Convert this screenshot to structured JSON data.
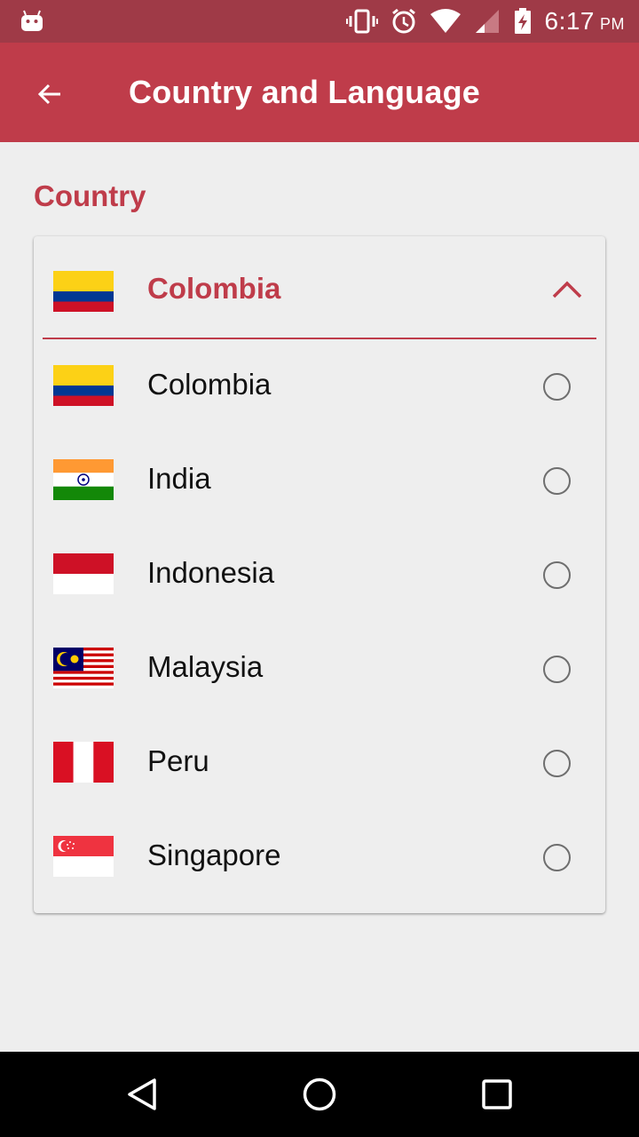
{
  "status_bar": {
    "time": "6:17",
    "ampm": "PM",
    "icons": [
      "android-debug-icon",
      "vibrate-icon",
      "alarm-icon",
      "wifi-icon",
      "cell-signal-icon",
      "battery-charging-icon"
    ]
  },
  "app_bar": {
    "title": "Country and Language",
    "back_icon": "arrow-left-icon"
  },
  "section": {
    "label": "Country"
  },
  "country_picker": {
    "selected": "Colombia",
    "expanded": true,
    "options": [
      {
        "name": "Colombia",
        "flag": "colombia-flag",
        "checked": false
      },
      {
        "name": "India",
        "flag": "india-flag",
        "checked": false
      },
      {
        "name": "Indonesia",
        "flag": "indonesia-flag",
        "checked": false
      },
      {
        "name": "Malaysia",
        "flag": "malaysia-flag",
        "checked": false
      },
      {
        "name": "Peru",
        "flag": "peru-flag",
        "checked": false
      },
      {
        "name": "Singapore",
        "flag": "singapore-flag",
        "checked": false
      }
    ]
  },
  "colors": {
    "status_bar": "#9f3a47",
    "app_bar": "#bf3c4a",
    "accent": "#bf3c4a",
    "background": "#eeeeee",
    "nav_bar": "#000000"
  },
  "nav_bar": {
    "icons": [
      "back-triangle-icon",
      "home-circle-icon",
      "recents-square-icon"
    ]
  }
}
